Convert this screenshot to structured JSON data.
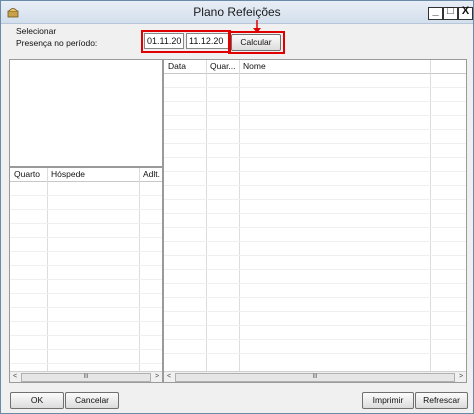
{
  "window": {
    "title": "Plano Refeições"
  },
  "controls": {
    "minimize": "_",
    "maximize": "□",
    "close": "X"
  },
  "filter": {
    "group_label": "Selecionar",
    "period_label": "Presença no período:",
    "date_from": "01.11.20",
    "date_to": "11.12.20",
    "calculate_label": "Calcular"
  },
  "lower_left_grid": {
    "columns": [
      "Quarto",
      "Hóspede",
      "Adlt."
    ]
  },
  "right_grid": {
    "columns": [
      "Data",
      "Quar...",
      "Nome"
    ]
  },
  "scrollbars": {
    "left_arrow": "<",
    "right_arrow": ">",
    "thumb": "III"
  },
  "buttons": {
    "ok": "OK",
    "cancel": "Cancelar",
    "print": "Imprimir",
    "refresh": "Refrescar"
  },
  "annotation": {
    "highlight_color": "#e00000"
  }
}
